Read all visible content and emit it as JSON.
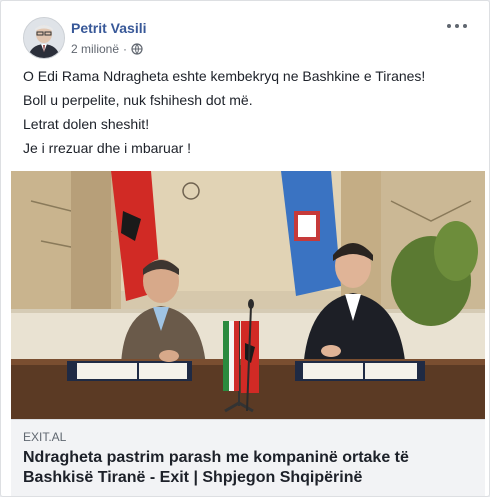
{
  "post": {
    "author": "Petrit Vasili",
    "time": "2 milionë",
    "separator": "·",
    "privacy_icon": "globe-icon",
    "menu_icon": "more-options-icon",
    "lines": [
      "O Edi Rama Ndragheta eshte kembekryq ne Bashkine e Tiranes!",
      "Boll u perpelite, nuk fshihesh dot më.",
      "Letrat dolen sheshit!",
      "Je i rrezuar dhe i mbaruar !"
    ]
  },
  "link": {
    "domain": "EXIT.AL",
    "title": "Ndragheta pastrim parash me kompaninë ortake të Bashkisë Tiranë - Exit | Shpjegon Shqipërinë"
  },
  "colors": {
    "author": "#385898",
    "text": "#1d2129",
    "meta": "#616770",
    "link_bg": "#f2f3f5"
  }
}
